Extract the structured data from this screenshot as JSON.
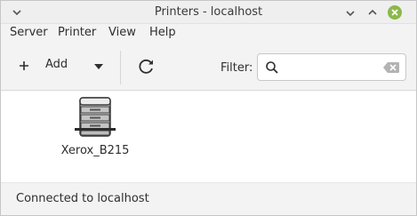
{
  "window": {
    "title": "Printers - localhost"
  },
  "menubar": {
    "items": [
      "Server",
      "Printer",
      "View",
      "Help"
    ]
  },
  "toolbar": {
    "add_label": "Add",
    "filter_label": "Filter:",
    "filter_value": ""
  },
  "printers": [
    {
      "name": "Xerox_B215"
    }
  ],
  "statusbar": {
    "text": "Connected to localhost"
  },
  "colors": {
    "close_button": "#8cb84a",
    "window_bg": "#f6f6f6",
    "content_bg": "#ffffff"
  }
}
